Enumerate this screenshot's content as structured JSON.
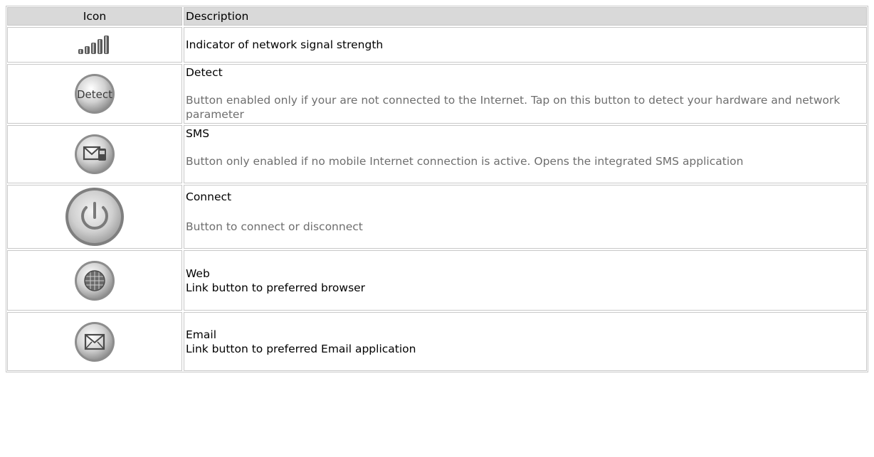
{
  "table": {
    "headers": {
      "icon": "Icon",
      "description": "Description"
    },
    "rows": [
      {
        "icon": "signal-strength-icon",
        "title": "Indicator of network signal strength",
        "text": ""
      },
      {
        "icon": "detect-icon",
        "icon_text": "Detect",
        "title": "Detect",
        "text": "Button enabled only if your are not connected to the Internet. Tap on this button to detect your hardware and network parameter"
      },
      {
        "icon": "sms-icon",
        "title": "SMS",
        "text": "Button only enabled if no mobile Internet connection is active. Opens the integrated SMS application"
      },
      {
        "icon": "power-icon",
        "title": "Connect",
        "text": "Button to connect or disconnect"
      },
      {
        "icon": "globe-icon",
        "title": "Web",
        "text": "Link button to preferred browser"
      },
      {
        "icon": "email-icon",
        "title": "Email",
        "text": "Link button to preferred Email application"
      }
    ]
  },
  "colors": {
    "border": "#c8c8c8",
    "header_bg": "#d9d9d9",
    "muted_text": "#6e6e6e"
  }
}
